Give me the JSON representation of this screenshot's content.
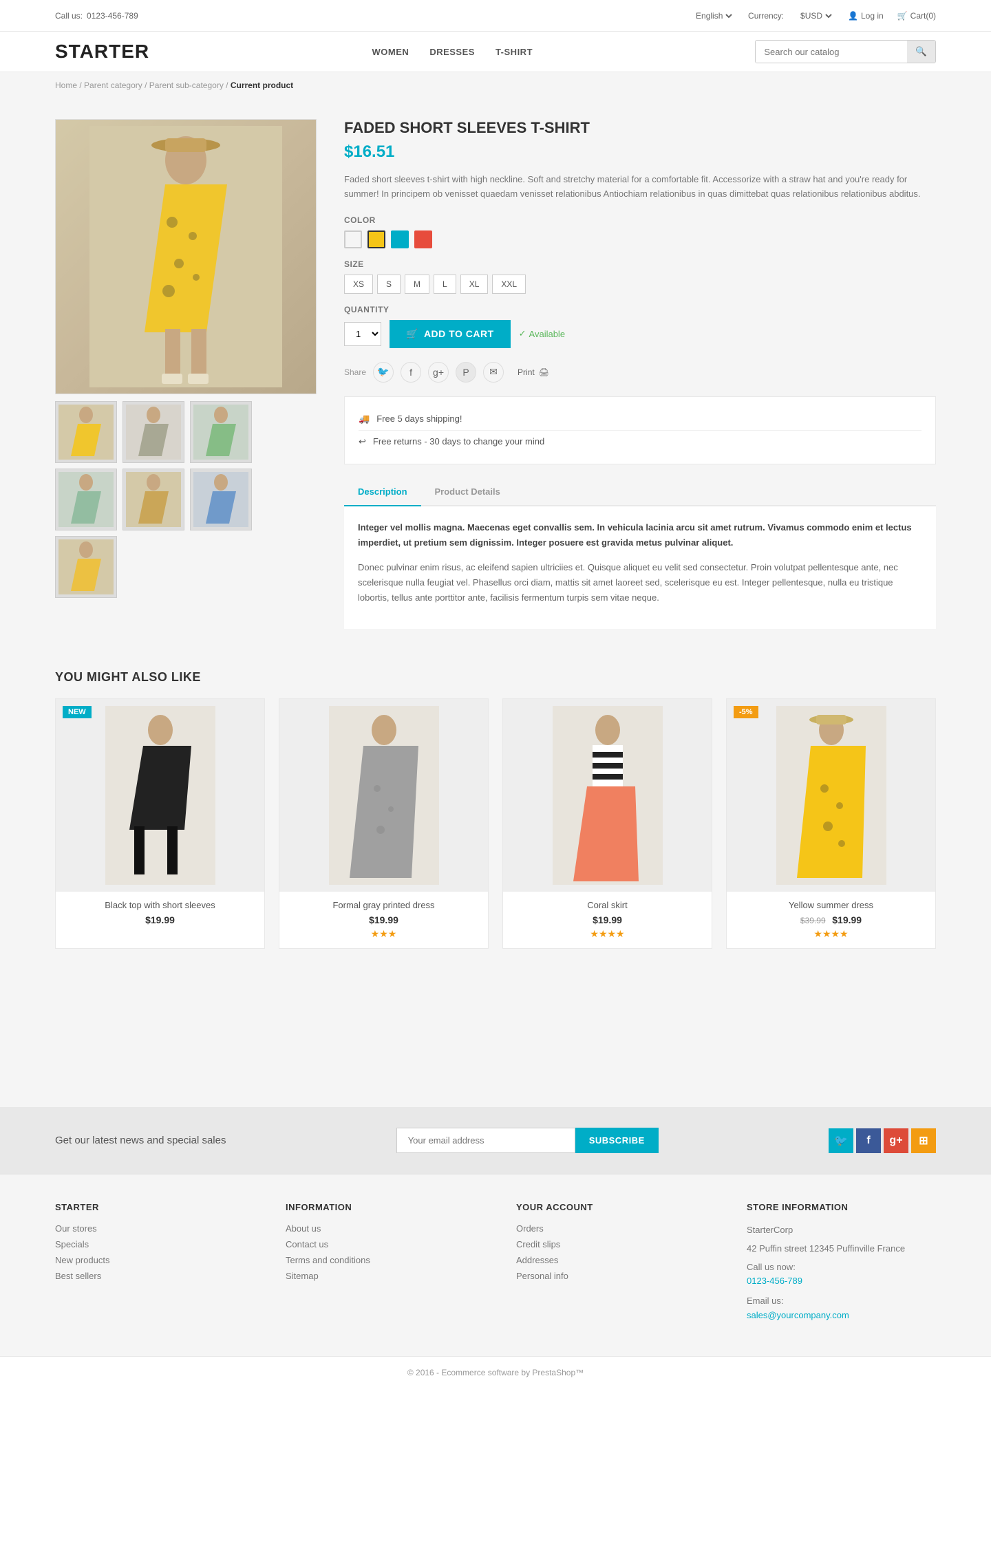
{
  "topbar": {
    "call_label": "Call us:",
    "phone": "0123-456-789",
    "language_label": "English",
    "currency_label": "Currency:",
    "currency_value": "$USD",
    "login_label": "Log in",
    "cart_label": "Cart(0)"
  },
  "header": {
    "logo": "STARTER",
    "nav": [
      {
        "label": "WOMEN",
        "href": "#"
      },
      {
        "label": "DRESSES",
        "href": "#"
      },
      {
        "label": "T-SHIRT",
        "href": "#"
      }
    ],
    "search_placeholder": "Search our catalog"
  },
  "breadcrumb": {
    "items": [
      "Home",
      "Parent category",
      "Parent sub-category"
    ],
    "current": "Current product"
  },
  "product": {
    "title": "FADED SHORT SLEEVES T-SHIRT",
    "price": "$16.51",
    "description": "Faded short sleeves t-shirt with high neckline. Soft and stretchy material for a comfortable fit. Accessorize with a straw hat and you're ready for summer! In principem ob venisset quaedam venisset relationibus Antiochiam relationibus in quas dimittebat quas relationibus relationibus abditus.",
    "colors": [
      {
        "name": "white",
        "hex": "#f5f5f5"
      },
      {
        "name": "yellow",
        "hex": "#f5c518"
      },
      {
        "name": "cyan",
        "hex": "#00adc7"
      },
      {
        "name": "red",
        "hex": "#e74c3c"
      }
    ],
    "selected_color": "yellow",
    "sizes": [
      "XS",
      "S",
      "M",
      "L",
      "XL",
      "XXL"
    ],
    "quantity_label": "Quantity",
    "quantity_value": "1",
    "add_to_cart_label": "ADD TO CART",
    "availability_label": "Available",
    "share_label": "Share",
    "print_label": "Print",
    "shipping_1": "Free 5 days shipping!",
    "shipping_2": "Free returns - 30 days to change your mind",
    "tab_description": "Description",
    "tab_product_details": "Product Details",
    "description_bold": "Integer vel mollis magna. Maecenas eget convallis sem. In vehicula lacinia arcu sit amet rutrum. Vivamus commodo enim et lectus imperdiet, ut pretium sem dignissim. Integer posuere est gravida metus pulvinar aliquet.",
    "description_normal": "Donec pulvinar enim risus, ac eleifend sapien ultriciies et. Quisque aliquet eu velit sed consectetur. Proin volutpat pellentesque ante, nec scelerisque nulla feugiat vel. Phasellus orci diam, mattis sit amet laoreet sed, scelerisque eu est. Integer pellentesque, nulla eu tristique lobortis, tellus ante porttitor ante, facilisis fermentum turpis sem vitae neque.",
    "main_image_emoji": "👗"
  },
  "thumbnails": [
    {
      "emoji": "👗"
    },
    {
      "emoji": "👗"
    },
    {
      "emoji": "👗"
    },
    {
      "emoji": "👗"
    },
    {
      "emoji": "👗"
    },
    {
      "emoji": "👗"
    },
    {
      "emoji": "👗"
    }
  ],
  "you_might_like": {
    "title": "YOU MIGHT ALSO LIKE",
    "products": [
      {
        "name": "Black top with short sleeves",
        "price": "$19.99",
        "old_price": null,
        "stars": 0,
        "badge": "NEW",
        "badge_type": "new",
        "emoji": "👚"
      },
      {
        "name": "Formal gray printed dress",
        "price": "$19.99",
        "old_price": null,
        "stars": 3,
        "badge": null,
        "badge_type": null,
        "emoji": "👗"
      },
      {
        "name": "Coral skirt",
        "price": "$19.99",
        "old_price": null,
        "stars": 4,
        "badge": null,
        "badge_type": null,
        "emoji": "👗"
      },
      {
        "name": "Yellow summer dress",
        "price": "$19.99",
        "old_price": "$39.99",
        "stars": 4,
        "badge": "-5%",
        "badge_type": "sale",
        "emoji": "👗"
      }
    ]
  },
  "newsletter": {
    "text": "Get our latest news and special sales",
    "placeholder": "Your email address",
    "button_label": "SUBSCRIBE"
  },
  "footer": {
    "columns": [
      {
        "title": "STARTER",
        "links": [
          "Our stores",
          "Specials",
          "New products",
          "Best sellers"
        ]
      },
      {
        "title": "INFORMATION",
        "links": [
          "About us",
          "Contact us",
          "Terms and conditions",
          "Sitemap"
        ]
      },
      {
        "title": "YOUR ACCOUNT",
        "links": [
          "Orders",
          "Credit slips",
          "Addresses",
          "Personal info"
        ]
      },
      {
        "title": "STORE INFORMATION",
        "company": "StarterCorp",
        "address": "42 Puffin street 12345 Puffinville France",
        "call_label": "Call us now:",
        "phone": "0123-456-789",
        "email_label": "Email us:",
        "email": "sales@yourcompany.com"
      }
    ]
  },
  "copyright": {
    "text": "© 2016 - Ecommerce software by PrestaShop™"
  }
}
